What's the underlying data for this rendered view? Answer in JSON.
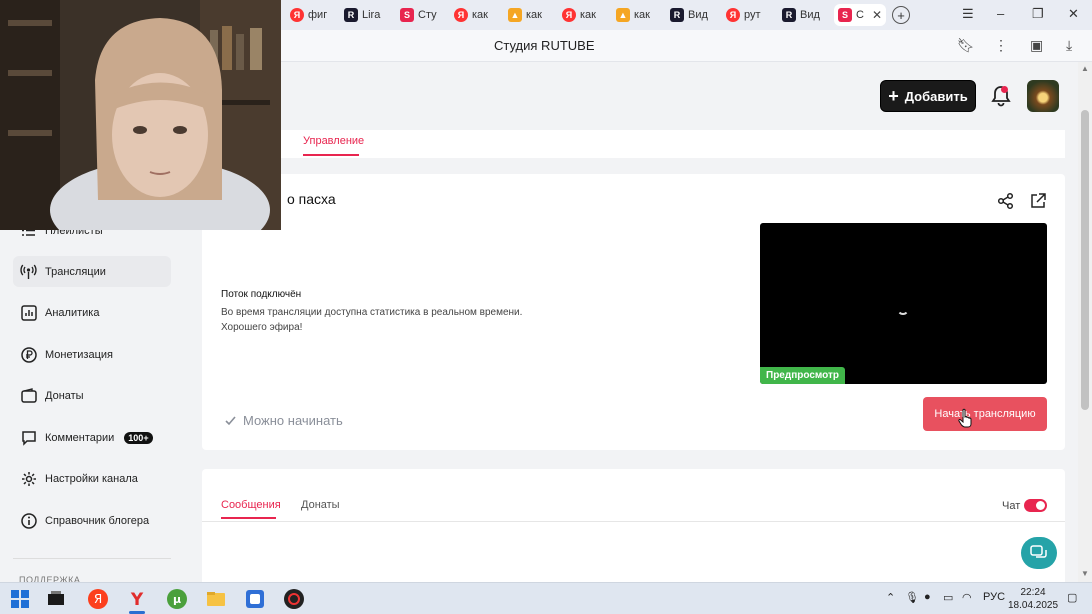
{
  "browser": {
    "tabs": [
      {
        "label": "фиг",
        "favicon": "yandex"
      },
      {
        "label": "Lira",
        "favicon": "rutube"
      },
      {
        "label": "Сту",
        "favicon": "studio"
      },
      {
        "label": "как",
        "favicon": "yandex"
      },
      {
        "label": "как",
        "favicon": "image"
      },
      {
        "label": "как",
        "favicon": "yandex"
      },
      {
        "label": "как",
        "favicon": "image"
      },
      {
        "label": "Вид",
        "favicon": "rutube"
      },
      {
        "label": "рут",
        "favicon": "yandex"
      },
      {
        "label": "Вид",
        "favicon": "rutube"
      },
      {
        "label": "С",
        "favicon": "studio"
      }
    ],
    "page_title": "Студия RUTUBE"
  },
  "header": {
    "add_label": "Добавить"
  },
  "top_tabs": {
    "manage": "Управление"
  },
  "stream": {
    "title": "о пасха",
    "status_title": "Поток подключён",
    "status_desc_1": "Во время трансляции доступна статистика в реальном времени.",
    "status_desc_2": "Хорошего эфира!",
    "preview_badge": "Предпросмотр",
    "ready_label": "Можно начинать",
    "start_label": "Начать трансляцию"
  },
  "chat": {
    "tab_messages": "Сообщения",
    "tab_donations": "Донаты",
    "toggle_label": "Чат",
    "toggle_on": true
  },
  "sidebar": {
    "items": [
      {
        "label": "Плейлисты",
        "icon": "list-icon"
      },
      {
        "label": "Трансляции",
        "icon": "broadcast-icon",
        "active": true
      },
      {
        "label": "Аналитика",
        "icon": "analytics-icon"
      },
      {
        "label": "Монетизация",
        "icon": "ruble-icon"
      },
      {
        "label": "Донаты",
        "icon": "wallet-icon"
      },
      {
        "label": "Комментарии",
        "icon": "comment-icon",
        "badge": "100+"
      },
      {
        "label": "Настройки канала",
        "icon": "gear-icon"
      },
      {
        "label": "Справочник блогера",
        "icon": "info-icon"
      }
    ],
    "section_label": "ПОДДЕРЖКА"
  },
  "taskbar": {
    "lang": "РУС",
    "time": "22:24",
    "date": "18.04.2025"
  },
  "colors": {
    "accent": "#e8254f",
    "start_button": "#e8515f",
    "preview_badge": "#41b64a",
    "help_fab": "#25a3a8"
  }
}
